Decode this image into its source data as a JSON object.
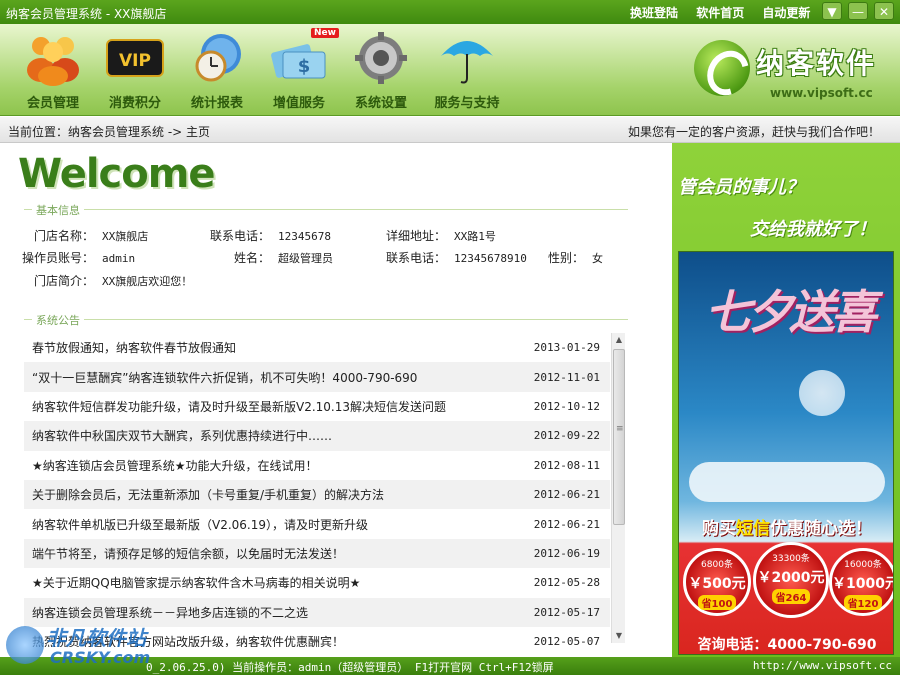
{
  "window": {
    "title": "纳客会员管理系统 - XX旗舰店",
    "links": [
      "换班登陆",
      "软件首页",
      "自动更新"
    ],
    "buttons": [
      "▼",
      "—",
      "✕"
    ]
  },
  "toolbar": {
    "items": [
      {
        "label": "会员管理",
        "icon": "members-icon"
      },
      {
        "label": "消费积分",
        "icon": "vip-card-icon"
      },
      {
        "label": "统计报表",
        "icon": "clock-globe-icon"
      },
      {
        "label": "增值服务",
        "icon": "money-card-icon",
        "badge": "New"
      },
      {
        "label": "系统设置",
        "icon": "gear-icon"
      },
      {
        "label": "服务与支持",
        "icon": "umbrella-icon"
      }
    ],
    "logo_name": "纳客软件",
    "logo_url": "www.vipsoft.cc"
  },
  "breadcrumb": {
    "path": "当前位置：纳客会员管理系统 -> 主页",
    "promo": "如果您有一定的客户资源，赶快与我们合作吧！"
  },
  "main": {
    "welcome": "Welcome",
    "basic_title": "基本信息",
    "store_name_label": "门店名称：",
    "store_name": "XX旗舰店",
    "phone_label": "联系电话：",
    "phone": "12345678",
    "address_label": "详细地址：",
    "address": "XX路1号",
    "operator_label": "操作员账号：",
    "operator": "admin",
    "name_label": "姓名：",
    "name": "超级管理员",
    "phone2_label": "联系电话：",
    "phone2": "12345678910",
    "gender_label": "性别：",
    "gender": "女",
    "intro_label": "门店简介：",
    "intro": "XX旗舰店欢迎您！",
    "notice_title": "系统公告",
    "notices": [
      {
        "title": "春节放假通知，纳客软件春节放假通知",
        "date": "2013-01-29"
      },
      {
        "title": "“双十一巨慧酬宾”纳客连锁软件六折促销，机不可失哟！4000-790-690",
        "date": "2012-11-01"
      },
      {
        "title": "纳客软件短信群发功能升级，请及时升级至最新版V2.10.13解决短信发送问题",
        "date": "2012-10-12"
      },
      {
        "title": "纳客软件中秋国庆双节大酬宾，系列优惠持续进行中……",
        "date": "2012-09-22"
      },
      {
        "title": "★纳客连锁店会员管理系统★功能大升级，在线试用！",
        "date": "2012-08-11"
      },
      {
        "title": "关于删除会员后，无法重新添加（卡号重复/手机重复）的解决方法",
        "date": "2012-06-21"
      },
      {
        "title": "纳客软件单机版已升级至最新版（V2.06.19），请及时更新升级",
        "date": "2012-06-21"
      },
      {
        "title": "端午节将至，请预存足够的短信余额，以免届时无法发送！",
        "date": "2012-06-19"
      },
      {
        "title": "★关于近期QQ电脑管家提示纳客软件含木马病毒的相关说明★",
        "date": "2012-05-28"
      },
      {
        "title": "纳客连锁会员管理系统－－异地多店连锁的不二之选",
        "date": "2012-05-17"
      },
      {
        "title": "热烈祝贺纳客软件官方网站改版升级，纳客软件优惠酬宾！",
        "date": "2012-05-07"
      }
    ]
  },
  "ad": {
    "q1": "管会员的事儿？",
    "q2": "交给我就好了！",
    "festival": "七夕送喜",
    "sms_pre": "购买",
    "sms_hi": "短信",
    "sms_post": "优惠随心选！",
    "offers": [
      {
        "count": "6800条",
        "price": "￥500元",
        "gift": "省100"
      },
      {
        "count": "33300条",
        "price": "￥2000元",
        "gift": "省264"
      },
      {
        "count": "16000条",
        "price": "￥1000元",
        "gift": "省120"
      }
    ],
    "tel": "咨询电话：4000-790-690"
  },
  "status": {
    "left": "0_2.06.25.0) 当前操作员：admin（超级管理员） F1打开官网 Ctrl+F12锁屏",
    "right": "http://www.vipsoft.cc"
  },
  "watermark": {
    "text": "非凡软件站",
    "sub": "CRSKY.com"
  }
}
